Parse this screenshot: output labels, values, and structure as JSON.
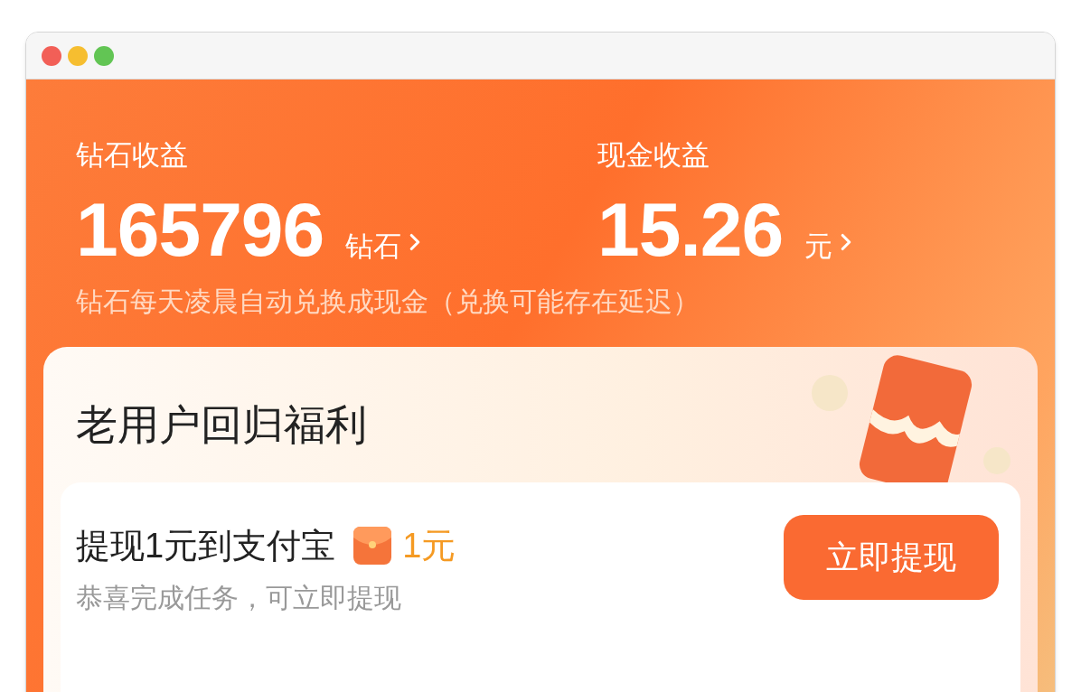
{
  "earnings": [
    {
      "label": "钻石收益",
      "value": "165796",
      "unit": "钻石"
    },
    {
      "label": "现金收益",
      "value": "15.26",
      "unit": "元"
    }
  ],
  "note": "钻石每天凌晨自动兑换成现金（兑换可能存在延迟）",
  "card": {
    "title": "老用户回归福利",
    "task": {
      "title": "提现1元到支付宝",
      "reward": "1元",
      "subtitle": "恭喜完成任务，可立即提现",
      "button": "立即提现"
    }
  }
}
